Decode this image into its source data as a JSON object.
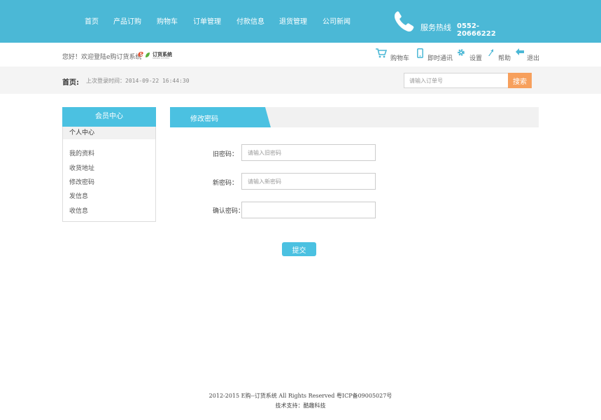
{
  "nav": {
    "items": [
      "首页",
      "产品订购",
      "购物车",
      "订单管理",
      "付款信息",
      "退货管理",
      "公司新闻"
    ]
  },
  "hotline": {
    "label": "服务热线",
    "number": "0552-20666222",
    "icon": "phone-icon"
  },
  "welcome": {
    "text": "您好！欢迎登陆e购订货系统",
    "brand_mark": "e",
    "brand_name": "订货系统",
    "brand_sub": "ORDER SYSTEM"
  },
  "utilities": [
    {
      "label": "购物车",
      "icon": "cart-icon"
    },
    {
      "label": "即时通讯",
      "icon": "mobile-icon"
    },
    {
      "label": "设置",
      "icon": "gear-icon"
    },
    {
      "label": "帮助",
      "icon": "help-arrow-icon"
    },
    {
      "label": "退出",
      "icon": "back-arrow-icon"
    }
  ],
  "crumb": {
    "title": "首页:",
    "last_login": "上次登录时间：2014-09-22 16:44:30"
  },
  "search": {
    "placeholder": "请输入订单号",
    "button": "搜索"
  },
  "sidebar": {
    "title": "会员中心",
    "section": "个人中心",
    "items": [
      "我的资料",
      "收货地址",
      "修改密码",
      "发信息",
      "收信息"
    ]
  },
  "form": {
    "tab": "修改密码",
    "fields": [
      {
        "label": "旧密码：",
        "placeholder": "请输入旧密码"
      },
      {
        "label": "新密码：",
        "placeholder": "请输入新密码"
      },
      {
        "label": "确认密码：",
        "placeholder": ""
      }
    ],
    "submit": "提交"
  },
  "footer": {
    "copyright": "2012-2015 E购--订货系统 All Rights Reserved 粤ICP备09005027号",
    "support": "技术支持：酷趣科技"
  },
  "colors": {
    "primary": "#4bb8d6",
    "accent": "#f7a05d",
    "sidebar_head": "#4bc1e1"
  }
}
